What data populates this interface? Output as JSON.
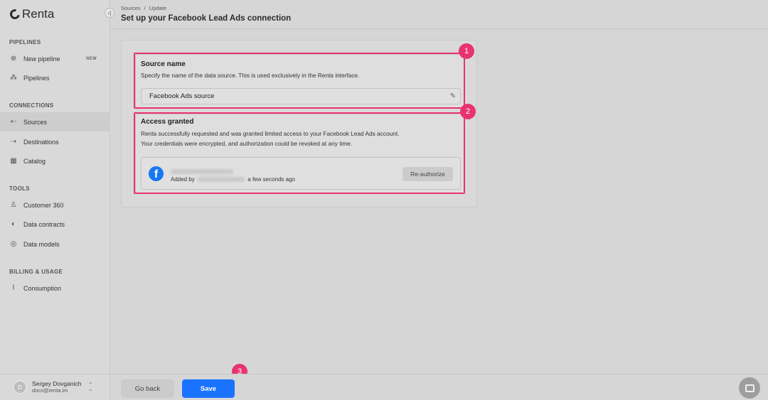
{
  "app": {
    "name": "Renta"
  },
  "sidebar": {
    "sections": [
      {
        "title": "PIPELINES",
        "items": [
          {
            "label": "New pipeline",
            "icon": "plus-circle-icon",
            "badge": "NEW"
          },
          {
            "label": "Pipelines",
            "icon": "pipelines-icon"
          }
        ]
      },
      {
        "title": "CONNECTIONS",
        "items": [
          {
            "label": "Sources",
            "icon": "sources-icon",
            "active": true
          },
          {
            "label": "Destinations",
            "icon": "destinations-icon"
          },
          {
            "label": "Catalog",
            "icon": "catalog-icon"
          }
        ]
      },
      {
        "title": "TOOLS",
        "items": [
          {
            "label": "Customer 360",
            "icon": "person-icon"
          },
          {
            "label": "Data contracts",
            "icon": "shield-icon"
          },
          {
            "label": "Data models",
            "icon": "database-icon"
          }
        ]
      },
      {
        "title": "BILLING & USAGE",
        "items": [
          {
            "label": "Consumption",
            "icon": "chart-icon"
          }
        ]
      }
    ],
    "user": {
      "initial": "D",
      "name": "Sergey Dovganich",
      "email": "docs@renta.im"
    }
  },
  "header": {
    "breadcrumb": {
      "parent": "Sources",
      "separator": "/",
      "current": "Update"
    },
    "title": "Set up your Facebook Lead Ads connection"
  },
  "source_name": {
    "title": "Source name",
    "description": "Specify the name of the data source. This is used exclusively in the Renta interface.",
    "input_value": "Facebook Ads source"
  },
  "access": {
    "title": "Access granted",
    "line1": "Renta successfully requested and was granted limited access to your Facebook Lead Ads account.",
    "line2": "Your credentials were encrypted, and authorization could be revoked at any time.",
    "added_prefix": "Added by",
    "added_suffix": "a few seconds ago",
    "reauthorize_label": "Re-authorize"
  },
  "markers": [
    "1",
    "2",
    "3"
  ],
  "footer": {
    "back_label": "Go back",
    "save_label": "Save"
  },
  "colors": {
    "highlight": "#e8336f",
    "primary": "#1a73ff",
    "facebook": "#1877f2"
  }
}
